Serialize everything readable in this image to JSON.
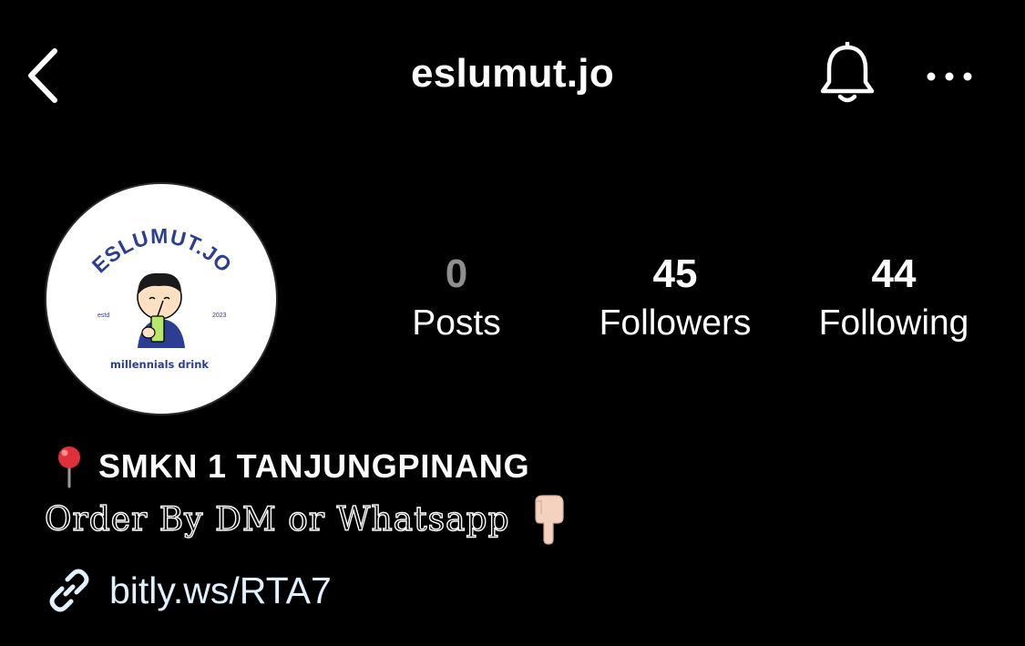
{
  "header": {
    "back_icon": "chevron-left-icon",
    "username": "eslumut.jo",
    "notification_icon": "bell-icon",
    "more_icon": "more-horizontal-icon"
  },
  "avatar": {
    "logo_text": "ESLUMUT.JO",
    "left_text": "estd",
    "right_text": "2023",
    "tagline": "millennials drink"
  },
  "stats": [
    {
      "value": "0",
      "label": "Posts"
    },
    {
      "value": "45",
      "label": "Followers"
    },
    {
      "value": "44",
      "label": "Following"
    }
  ],
  "bio": {
    "location_icon": "pushpin-icon",
    "name": "SMKN 1 TANJUNGPINANG",
    "line": "Order By DM or Whatsapp",
    "point_icon": "pointing-down-hand-icon",
    "link_icon": "link-icon",
    "link": "bitly.ws/RTA7"
  },
  "colors": {
    "background": "#000000",
    "text": "#ffffff",
    "muted": "#8e8e8e",
    "link": "#e0f1ff",
    "logo_blue": "#2c3e8f",
    "cup_green": "#b8e86a"
  }
}
